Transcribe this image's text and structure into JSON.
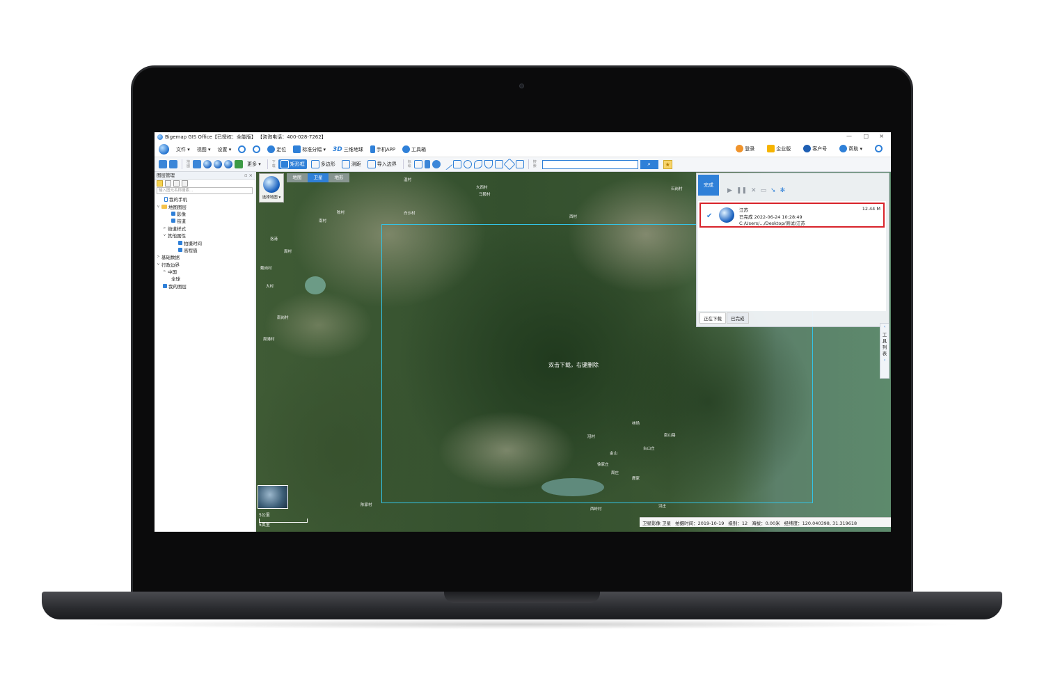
{
  "window": {
    "title": "Bigemap GIS Office【已授权：全能版】  【咨询电话：400-028-7262】",
    "minimize": "—",
    "maximize": "□",
    "close": "×"
  },
  "menu": {
    "items": [
      {
        "label": "文件 ▾"
      },
      {
        "label": "视图 ▾"
      },
      {
        "label": "设置 ▾"
      }
    ],
    "locate": "定位",
    "standard_grid": "标准分幅 ▾",
    "three_d_mark": "3D",
    "three_d_globe": "三维地球",
    "mobile_app": "手机APP",
    "toolbox": "工具箱",
    "right": {
      "login": "登录",
      "enterprise": "企业版",
      "customer": "客户号",
      "help": "帮助 ▾"
    }
  },
  "toolbar": {
    "more": "更多 ▾",
    "rectangle": "矩形框",
    "polygon": "多边形",
    "measure": "测距",
    "import_border": "导入边界",
    "download_side_label": "下载",
    "map_side_label": "地图",
    "mark_side_label": "标绘",
    "search_side_label": "搜索",
    "search_btn": "⌕",
    "star": "★"
  },
  "layer_panel": {
    "title": "图层管理",
    "pin": "▫ ×",
    "search_placeholder": "输入图元名称搜索...",
    "tree": [
      {
        "label": "我的手机",
        "level": 1,
        "icon": "phone"
      },
      {
        "label": "地图图层",
        "level": 0,
        "icon": "folder",
        "arrow": "v"
      },
      {
        "label": "影像",
        "level": 2,
        "icon": "check"
      },
      {
        "label": "街道",
        "level": 2,
        "icon": "check"
      },
      {
        "label": "街道样式",
        "level": 1,
        "icon": "none",
        "arrow": ">"
      },
      {
        "label": "其他属性",
        "level": 1,
        "icon": "none",
        "arrow": "v"
      },
      {
        "label": "拍摄时间",
        "level": 3,
        "icon": "check"
      },
      {
        "label": "高程值",
        "level": 3,
        "icon": "check"
      },
      {
        "label": "基础数据",
        "level": 0,
        "icon": "none",
        "arrow": ">"
      },
      {
        "label": "行政边界",
        "level": 0,
        "icon": "none",
        "arrow": "v"
      },
      {
        "label": "中国",
        "level": 1,
        "icon": "none",
        "arrow": ">"
      },
      {
        "label": "全球",
        "level": 2,
        "icon": "none"
      },
      {
        "label": "我的图层",
        "level": 0,
        "icon": "check"
      }
    ]
  },
  "map": {
    "tabs": [
      {
        "label": "地图",
        "active": false
      },
      {
        "label": "卫星",
        "active": true
      },
      {
        "label": "地形",
        "active": false
      }
    ],
    "selector_label": "选择地图 ▾",
    "center_hint": "双击下载，右键删除",
    "labels": [
      "温村",
      "大西村",
      "马鞍村",
      "白沙村",
      "陈村",
      "南村",
      "洛港",
      "周村",
      "戴岗村",
      "大村",
      "南岗村",
      "周港村",
      "冠村",
      "林场",
      "金山",
      "徐家庄",
      "古山庄",
      "南山路",
      "周庄",
      "鹿家",
      "洪庄",
      "西岭村",
      "石岗村",
      "陈家村",
      "西村"
    ],
    "scale_label": "5公里",
    "scale_label2": "5英里",
    "status": {
      "source": "卫星影像 卫星",
      "capture": "拍摄时间：2019-10-19",
      "level": "级别：12",
      "altitude": "海拔：0.00米",
      "coords": "经纬度：120.040398, 31.319618"
    }
  },
  "download_panel": {
    "status_tab": "完成",
    "item": {
      "name": "江苏",
      "done": "已完成 2022-06-24 10:28:49",
      "path": "C:/Users/.../Desktop/测试/江苏",
      "size": "12.44 M"
    },
    "tabs": [
      {
        "label": "正在下载",
        "selected": false
      },
      {
        "label": "已完成",
        "selected": true
      }
    ],
    "controls": {
      "play": "▶",
      "pause": "❚❚",
      "cancel": "✕",
      "folder": "▭",
      "arrow": "➘",
      "gear": "✻"
    }
  },
  "side_tools": {
    "top": "‹",
    "label": "工具列表",
    "bottom": "‹"
  }
}
